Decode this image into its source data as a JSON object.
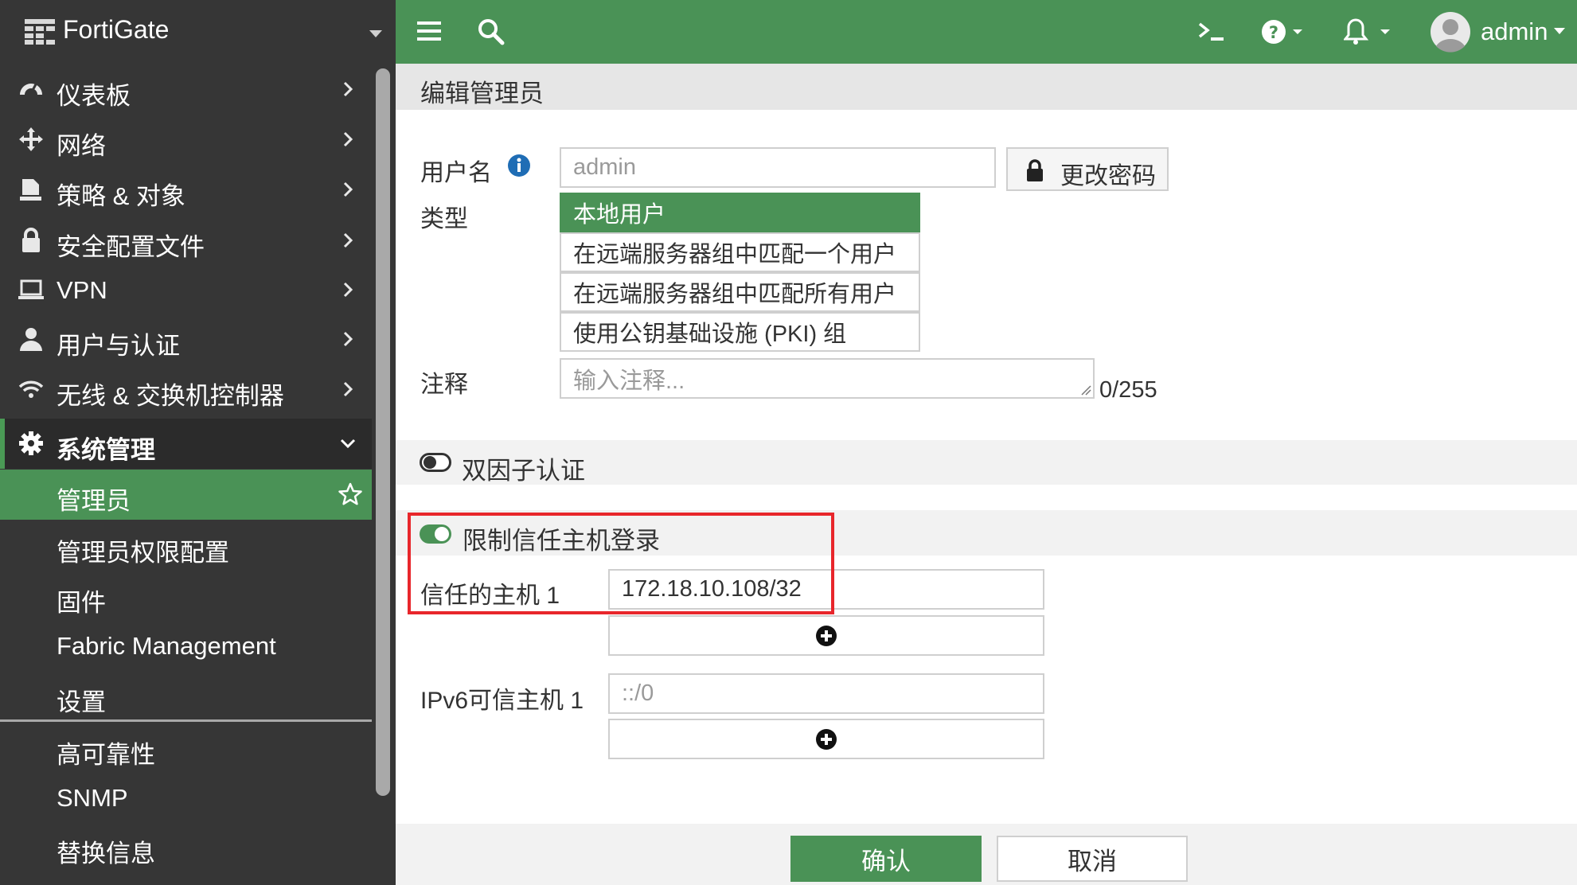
{
  "brand": {
    "name": "FortiGate"
  },
  "colors": {
    "accent": "#4a9256",
    "sidebar_bg": "#363636",
    "highlight": "#e8262b"
  },
  "sidebar": {
    "items": [
      {
        "label": "仪表板",
        "icon": "dashboard-icon"
      },
      {
        "label": "网络",
        "icon": "network-move-icon"
      },
      {
        "label": "策略 & 对象",
        "icon": "policy-document-icon"
      },
      {
        "label": "安全配置文件",
        "icon": "lock-icon"
      },
      {
        "label": "VPN",
        "icon": "laptop-icon"
      },
      {
        "label": "用户与认证",
        "icon": "user-icon"
      },
      {
        "label": "无线 & 交换机控制器",
        "icon": "wifi-icon"
      },
      {
        "label": "系统管理",
        "icon": "gear-icon",
        "expanded": true
      }
    ],
    "sub_items": [
      {
        "label": "管理员",
        "selected": true
      },
      {
        "label": "管理员权限配置"
      },
      {
        "label": "固件"
      },
      {
        "label": "Fabric Management"
      },
      {
        "label": "设置"
      },
      {
        "label": "高可靠性"
      },
      {
        "label": "SNMP"
      },
      {
        "label": "替换信息"
      }
    ]
  },
  "topbar": {
    "user_name": "admin"
  },
  "page": {
    "title": "编辑管理员"
  },
  "form": {
    "username_label": "用户名",
    "username_value": "admin",
    "change_password_label": "更改密码",
    "type_label": "类型",
    "type_options": [
      {
        "label": "本地用户",
        "selected": true
      },
      {
        "label": "在远端服务器组中匹配一个用户"
      },
      {
        "label": "在远端服务器组中匹配所有用户"
      },
      {
        "label": "使用公钥基础设施 (PKI) 组"
      }
    ],
    "comment_label": "注释",
    "comment_placeholder": "输入注释...",
    "comment_count": "0/255",
    "two_factor_label": "双因子认证",
    "two_factor_enabled": false,
    "restrict_trusted_label": "限制信任主机登录",
    "restrict_trusted_enabled": true,
    "trusted_host_label": "信任的主机 1",
    "trusted_host_value": "172.18.10.108/32",
    "ipv6_host_label": "IPv6可信主机 1",
    "ipv6_host_value": "::/0"
  },
  "buttons": {
    "ok": "确认",
    "cancel": "取消"
  }
}
